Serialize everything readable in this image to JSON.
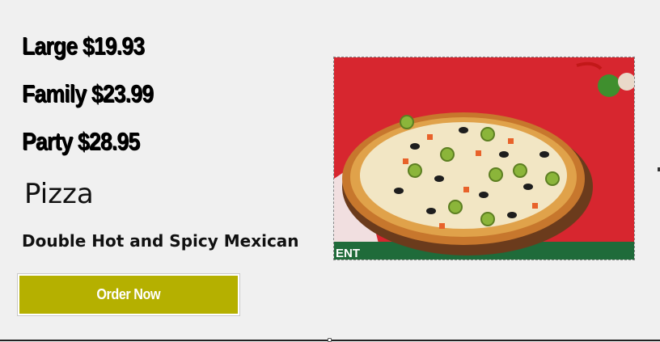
{
  "prices": {
    "large": "Large $19.93",
    "family": "Family $23.99",
    "party": "Party $28.95"
  },
  "product": {
    "title": "Pizza",
    "subtitle": "Double Hot and Spicy Mexican"
  },
  "order_button": {
    "label": "Order Now"
  },
  "image": {
    "banner_text": "ENT"
  },
  "colors": {
    "background": "#f0f0f0",
    "button": "#b5b000",
    "image_backdrop": "#d7262f",
    "banner": "#1f6b3a"
  }
}
